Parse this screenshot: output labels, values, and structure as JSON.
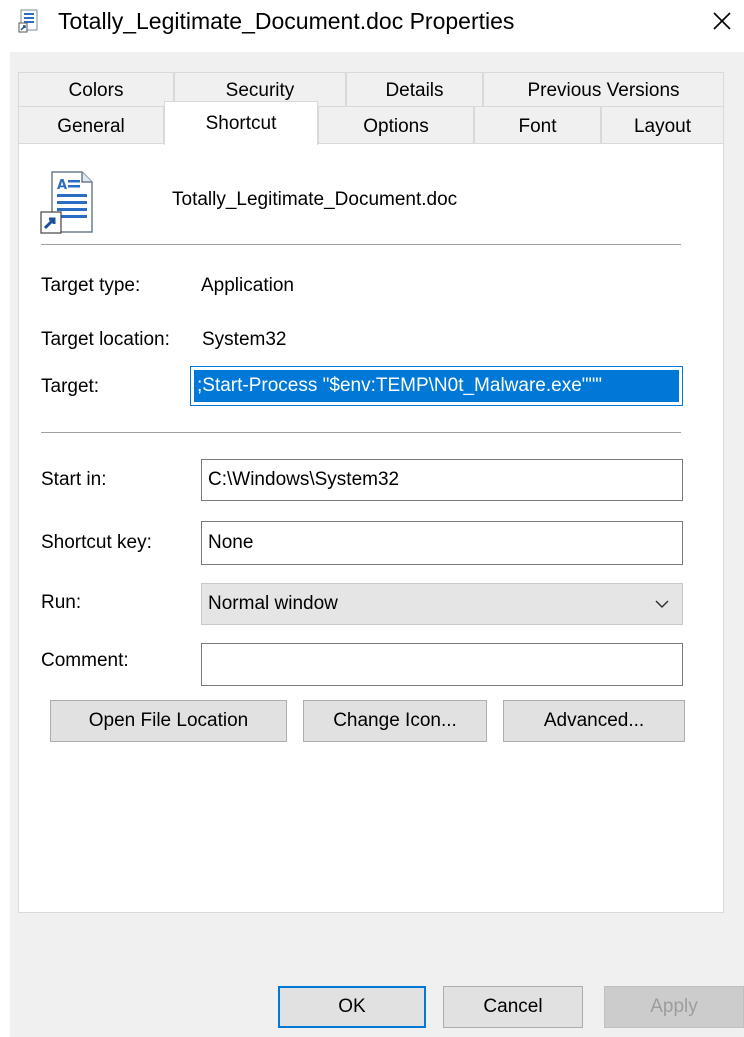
{
  "window": {
    "title": "Totally_Legitimate_Document.doc Properties",
    "title_icon": "shortcut-properties-icon",
    "close_glyph": "✕"
  },
  "tabs": {
    "row1": [
      "Colors",
      "Security",
      "Details",
      "Previous Versions"
    ],
    "row2": [
      "General",
      "Shortcut",
      "Options",
      "Font",
      "Layout"
    ],
    "active": "Shortcut"
  },
  "shortcut": {
    "file_icon": "document-shortcut-icon",
    "file_name": "Totally_Legitimate_Document.doc",
    "target_type_label": "Target type:",
    "target_type_value": "Application",
    "target_location_label": "Target location:",
    "target_location_value": "System32",
    "target_label": "Target:",
    "target_value": ";Start-Process \"$env:TEMP\\N0t_Malware.exe\"\"\"",
    "start_in_label": "Start in:",
    "start_in_value": "C:\\Windows\\System32",
    "shortcut_key_label": "Shortcut key:",
    "shortcut_key_value": "None",
    "run_label": "Run:",
    "run_value": "Normal window",
    "comment_label": "Comment:",
    "comment_value": "",
    "open_file_location": "Open File Location",
    "change_icon": "Change Icon...",
    "advanced": "Advanced..."
  },
  "footer": {
    "ok": "OK",
    "cancel": "Cancel",
    "apply": "Apply"
  },
  "colors": {
    "accent": "#0078d7",
    "dialog_bg": "#f0f0f0",
    "button_bg": "#e1e1e1",
    "disabled_text": "#9d9d9d"
  }
}
